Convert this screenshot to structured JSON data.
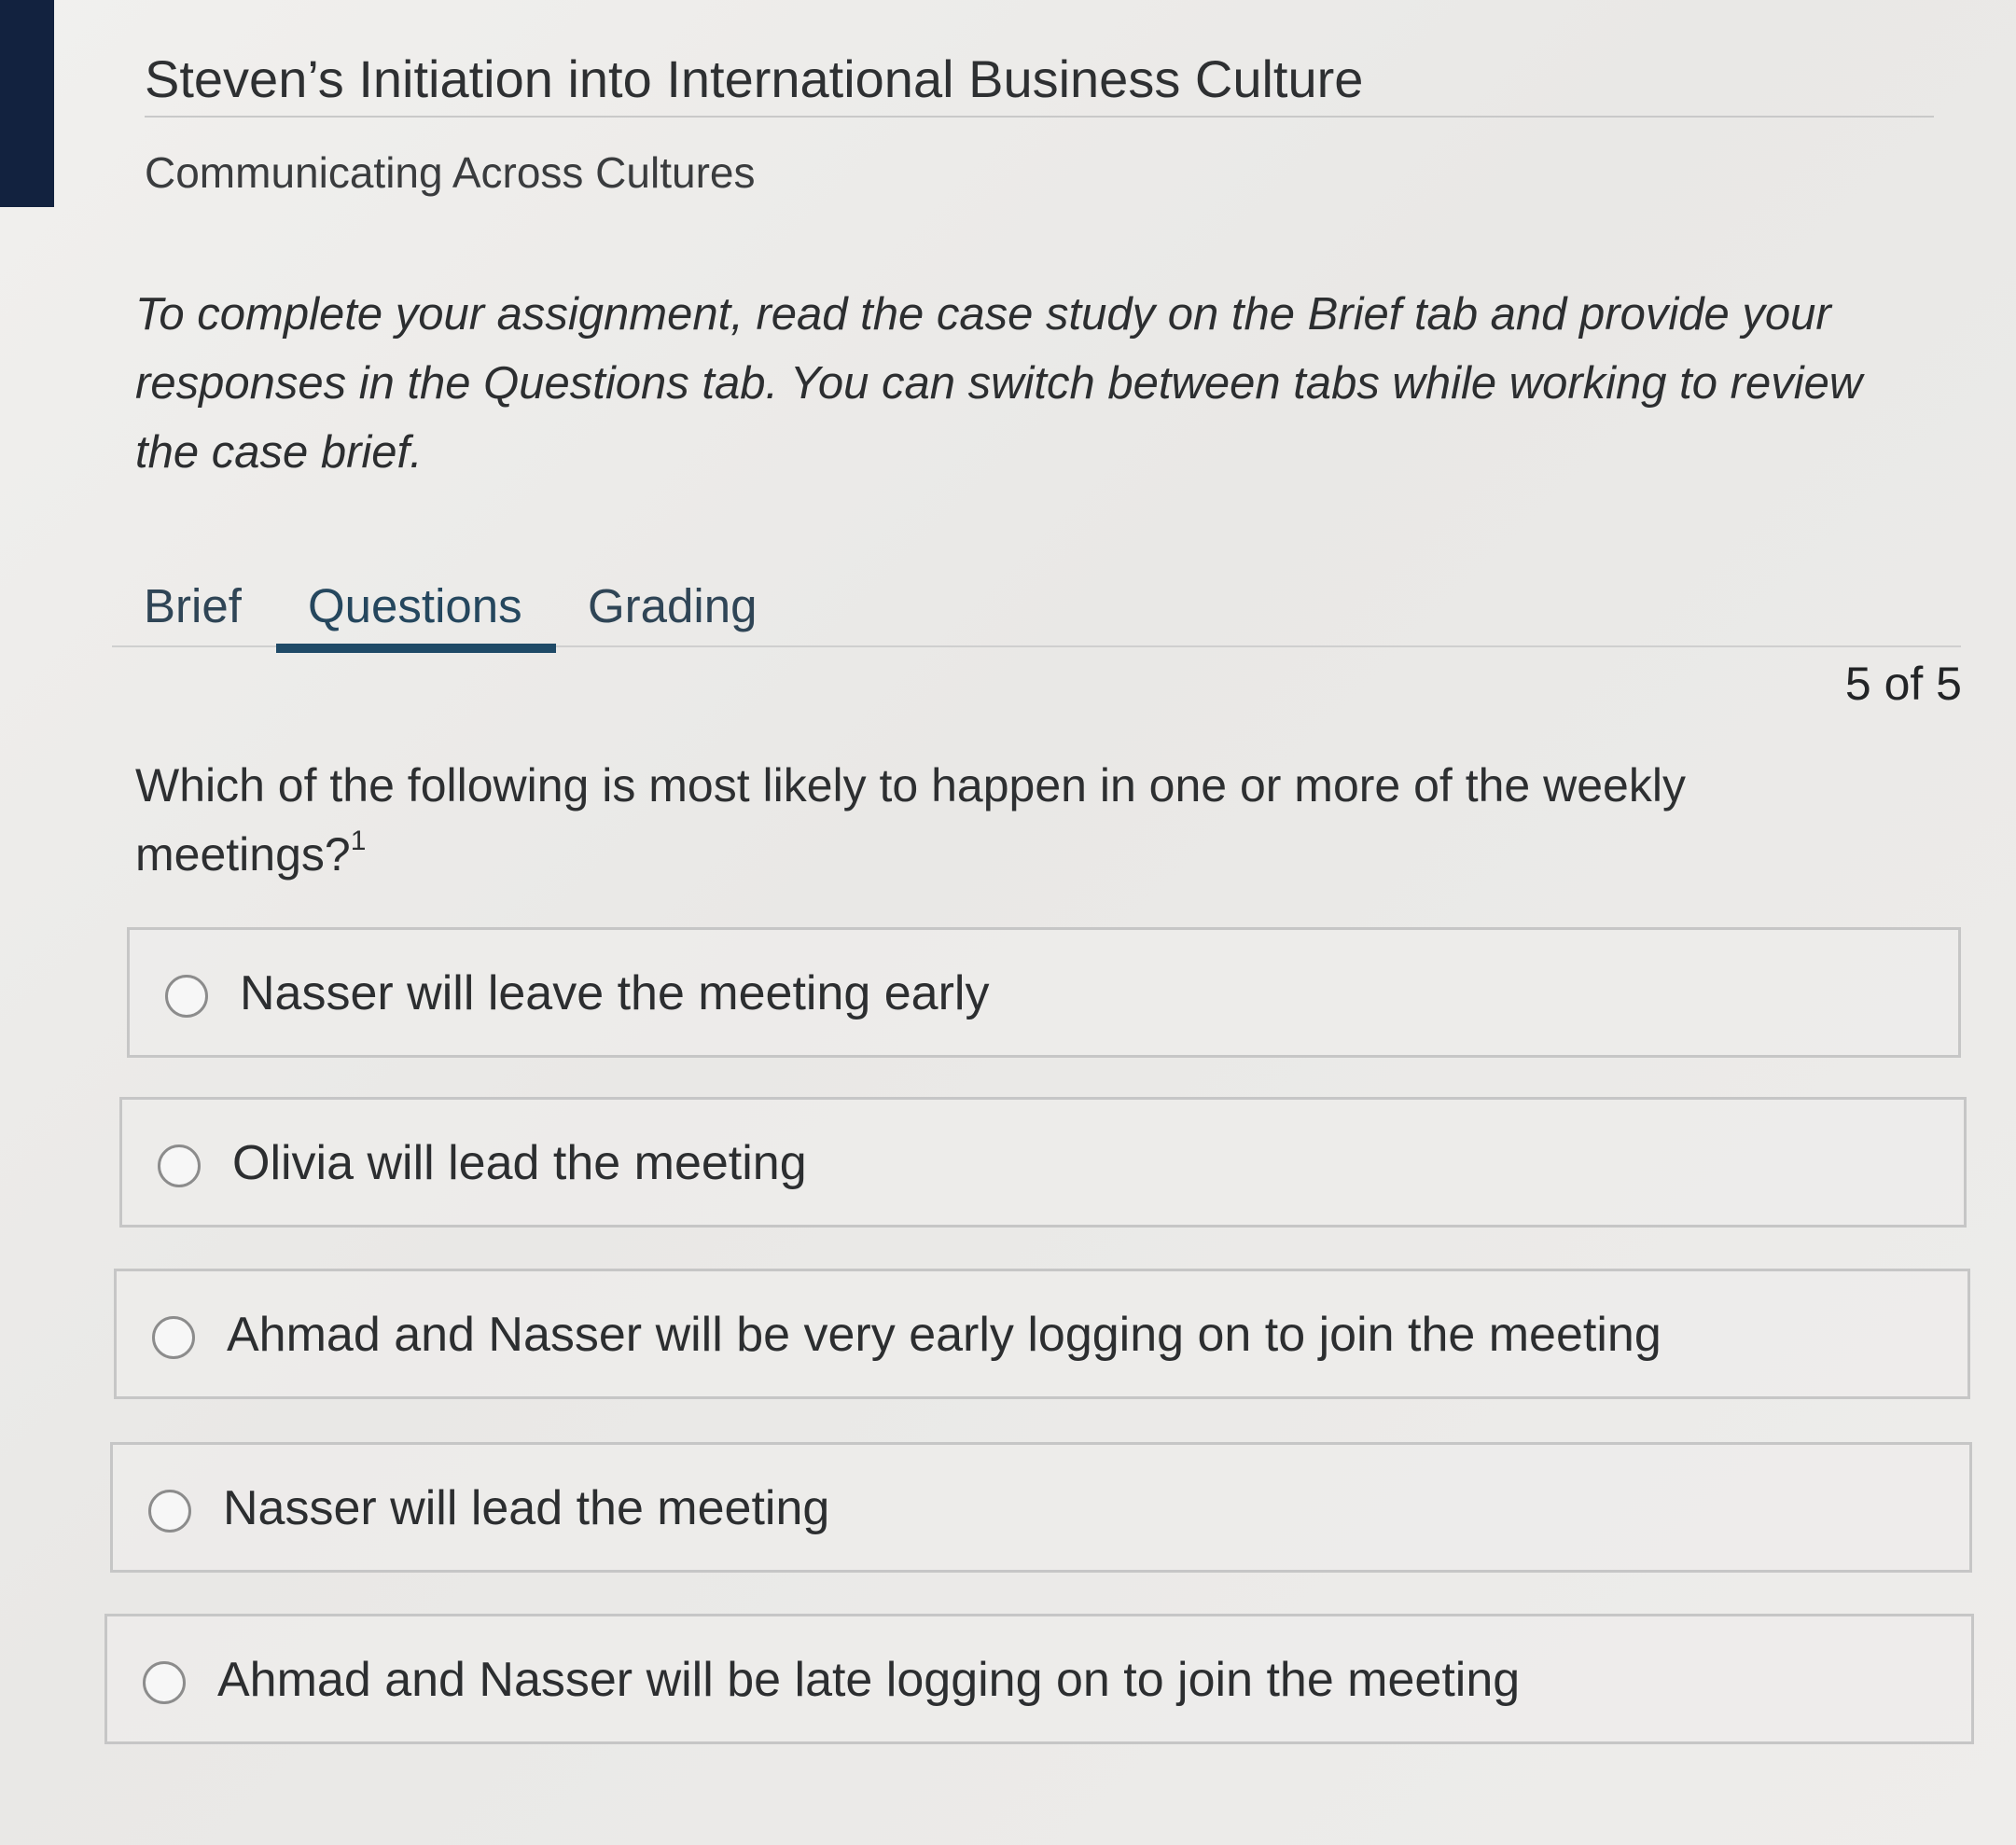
{
  "header": {
    "title": "Steven’s Initiation into International Business Culture",
    "subtitle": "Communicating Across Cultures"
  },
  "instructions": "To complete your assignment, read the case study on the Brief tab and provide your responses in the Questions tab. You can switch between tabs while working to review the case brief.",
  "tabs": [
    {
      "label": "Brief",
      "active": false
    },
    {
      "label": "Questions",
      "active": true
    },
    {
      "label": "Grading",
      "active": false
    }
  ],
  "progress": {
    "current": 5,
    "total": 5,
    "label": "5 of 5"
  },
  "question": {
    "text": "Which of the following is most likely to happen in one or more of the weekly meetings?",
    "footnote": "1"
  },
  "options": [
    {
      "label": "Nasser will leave the meeting early",
      "selected": false
    },
    {
      "label": "Olivia will lead the meeting",
      "selected": false
    },
    {
      "label": "Ahmad and Nasser will be very early logging on to join the meeting",
      "selected": false
    },
    {
      "label": "Nasser will lead the meeting",
      "selected": false
    },
    {
      "label": "Ahmad and Nasser will be late logging on to join the meeting",
      "selected": false
    }
  ],
  "colors": {
    "accent_tab_underline": "#1f4a67",
    "sidebar_accent": "#12223f"
  }
}
